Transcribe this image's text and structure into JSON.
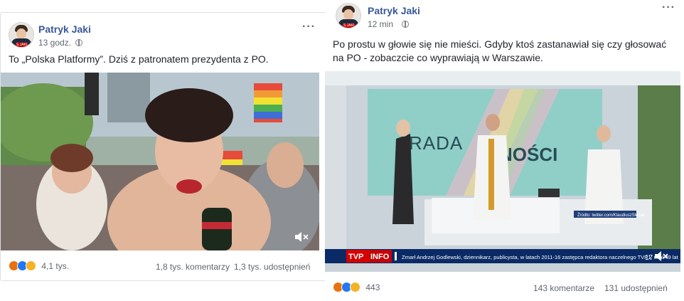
{
  "left_post": {
    "author": "Patryk Jaki",
    "time": "13 godz.",
    "text": "To „Polska Platformy”. Dziś z patronatem prezydenta z PO.",
    "reactions_count": "4,1 tys.",
    "comments": "1,8 tys. komentarzy",
    "shares": "1,3 tys. udostępnień",
    "reactions": [
      "angry-icon",
      "like-icon",
      "haha-icon"
    ]
  },
  "right_post": {
    "author": "Patryk Jaki",
    "time": "12 min",
    "text_line1": "Po prostu w głowie się nie mieści. Gdyby ktoś zastanawiał się czy głosować",
    "text_line2": "na PO - zobaczcie co wyprawiają w Warszawie.",
    "video_banner_word1": "RADA",
    "video_banner_word2": "NOŚCI",
    "source_tag": "Źródło: twitter.com/KlaudiuszSlezak",
    "tvp_logo": "TVP",
    "tvp_info": "INFO",
    "ticker": "Zmarł Andrzej Godlewski, dziennikarz, publicysta, w latach 2011-16 zastępca redaktora naczelnego TVP1; miał 49 lat",
    "ticker_time": "17",
    "reactions_count": "443",
    "comments": "143 komentarze",
    "shares": "131 udostępnień",
    "reactions": [
      "angry-icon",
      "like-icon",
      "sad-icon"
    ]
  },
  "colors": {
    "link": "#385898",
    "meta": "#616770",
    "tvp_red": "#d50000",
    "ticker_blue": "#0a2a66"
  }
}
